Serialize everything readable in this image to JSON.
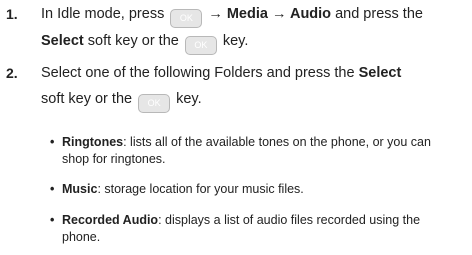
{
  "steps": [
    {
      "number": "1.",
      "line1_pre": "In Idle mode, press",
      "line1_path": "→ Media → Audio",
      "line1_post": "and press the",
      "line2_select": "Select",
      "line2_mid": "soft key or the",
      "line2_end": "key."
    },
    {
      "number": "2.",
      "line1_pre": "Select one of the following Folders and press the",
      "line1_select": "Select",
      "line2_pre": "soft key or the",
      "line2_end": "key."
    }
  ],
  "ok_key_label": "OK",
  "folders": [
    {
      "name": "Ringtones",
      "desc_line1": ": lists all of the available tones on the phone, or you can",
      "desc_line2": "shop for ringtones."
    },
    {
      "name": "Music",
      "desc_line1": ": storage location for your music files."
    },
    {
      "name": "Recorded Audio",
      "desc_line1": ": displays a list of audio files recorded using the",
      "desc_line2": "phone."
    }
  ],
  "bullet_glyph": "•"
}
